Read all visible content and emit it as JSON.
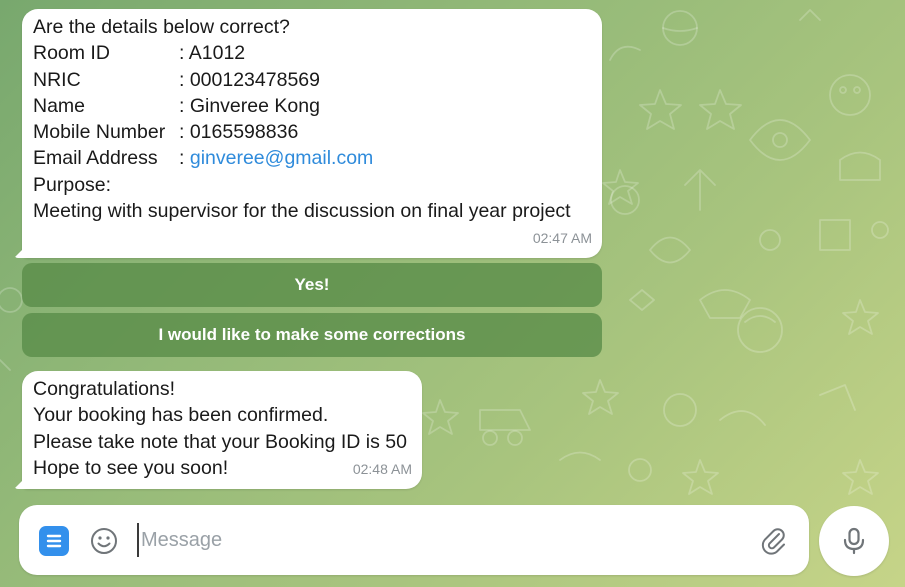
{
  "theme": {
    "accent": "#3390ec",
    "link": "#2f8bdb",
    "button_bg": "#6a9c58"
  },
  "messages": [
    {
      "intro": "Are the details below correct?",
      "fields": [
        {
          "label": "Room ID",
          "value": ": A1012"
        },
        {
          "label": "NRIC",
          "value": ": 000123478569"
        },
        {
          "label": "Name",
          "value": ": Ginveree Kong"
        },
        {
          "label": "Mobile Number",
          "value": ": 0165598836"
        },
        {
          "label": "Email Address",
          "value_prefix": ": ",
          "value": "ginveree@gmail.com"
        }
      ],
      "purpose_label": "Purpose:",
      "purpose_text": "Meeting with supervisor for the discussion on final year project",
      "time": "02:47 AM",
      "buttons": [
        "Yes!",
        "I would like to make some corrections"
      ]
    },
    {
      "lines": [
        "Congratulations!",
        "Your booking has been confirmed.",
        "Please take note that your Booking ID is 50",
        "Hope to see you soon!"
      ],
      "time": "02:48 AM"
    }
  ],
  "composer": {
    "placeholder": "Message",
    "value": "",
    "icons": {
      "menu": "menu-icon",
      "emoji": "smiley-icon",
      "attach": "paperclip-icon",
      "mic": "microphone-icon"
    }
  }
}
